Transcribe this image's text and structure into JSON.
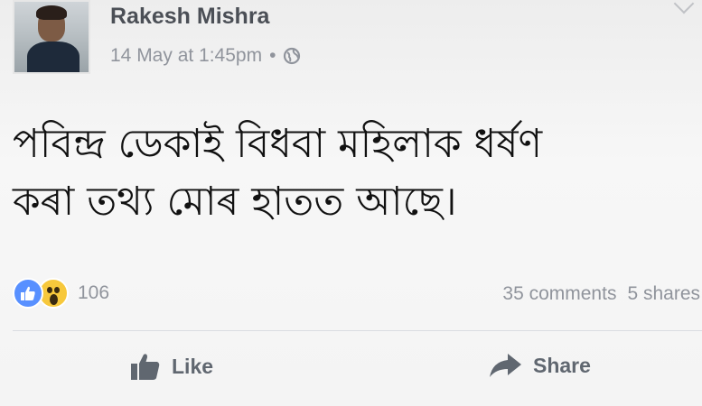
{
  "post": {
    "author": "Rakesh Mishra",
    "timestamp": "14 May at 1:45pm",
    "separator": "•",
    "privacy_icon": "globe-icon",
    "text_line_1": "পবিন্দ্র ডেকাই বিধবা মহিলাক ধৰ্ষণ",
    "text_line_2": "কৰা তথ্য মোৰ হাতত আছে।"
  },
  "stats": {
    "reaction_icons": [
      "like-icon",
      "wow-icon"
    ],
    "reaction_count": "106",
    "comments": "35 comments",
    "shares": "5 shares"
  },
  "actions": {
    "like_label": "Like",
    "share_label": "Share"
  },
  "colors": {
    "like_blue": "#5890ff",
    "wow_yellow": "#f7c83c",
    "meta_gray": "#90949c",
    "action_gray": "#606770"
  }
}
